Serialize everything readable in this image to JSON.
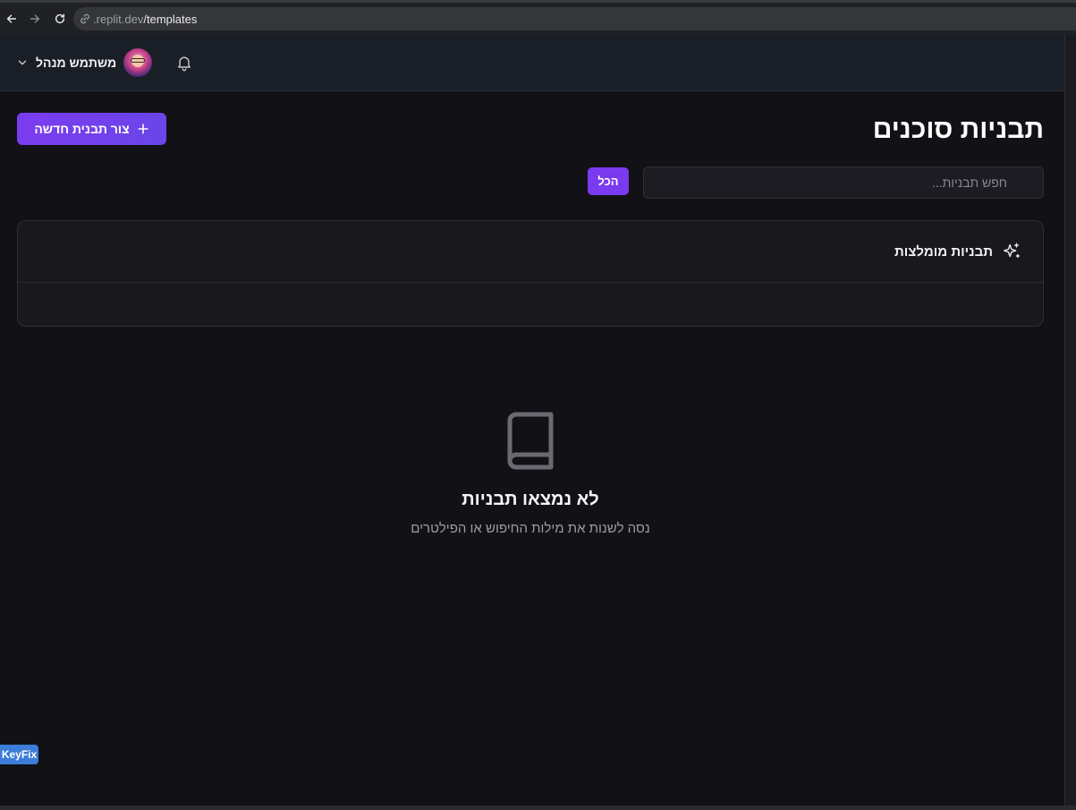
{
  "browser": {
    "url_host": ".replit.dev",
    "url_path": "/templates"
  },
  "header": {
    "user_name": "משתמש מנהל"
  },
  "main": {
    "title": "תבניות סוכנים",
    "create_label": "צור תבנית חדשה",
    "search_placeholder": "חפש תבניות...",
    "filter_label": "הכל",
    "recommended_title": "תבניות מומלצות",
    "empty_title": "לא נמצאו תבניות",
    "empty_subtitle": "נסה לשנות את מילות החיפוש או הפילטרים"
  },
  "badge": {
    "label": "KeyFix"
  },
  "colors": {
    "accent": "#7a3aef",
    "background": "#111116",
    "badge": "#3b7dd8"
  }
}
